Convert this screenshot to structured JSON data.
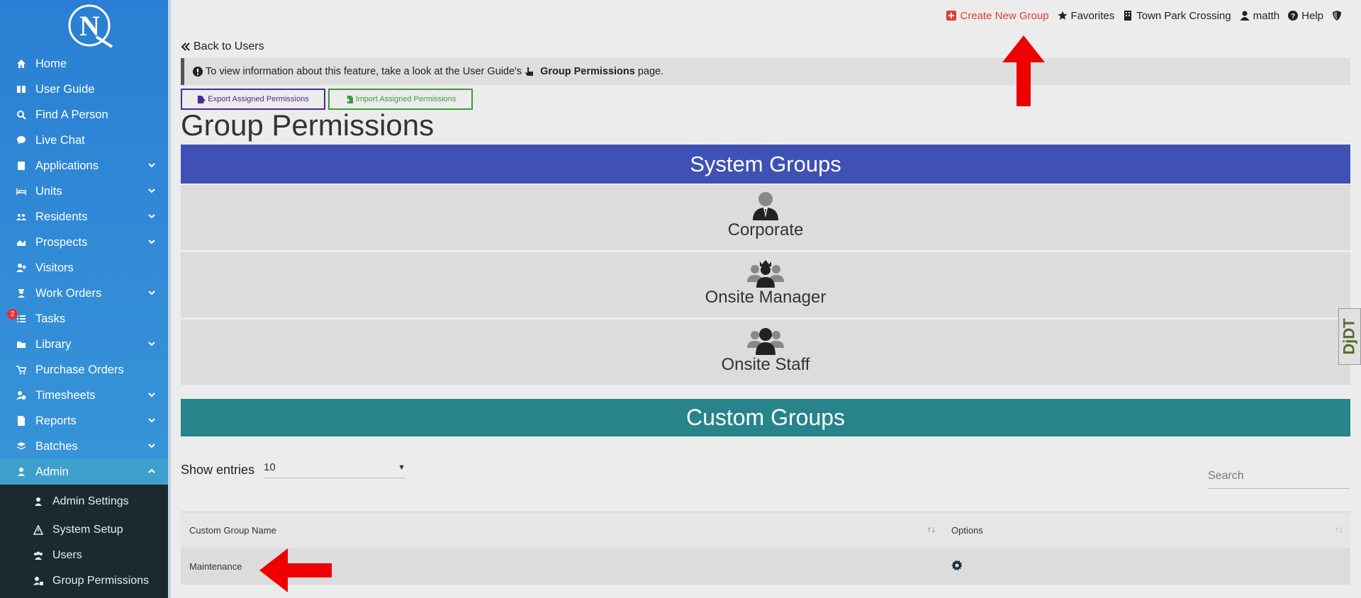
{
  "sidebar": {
    "logo_letters": "NQ",
    "items": [
      {
        "label": "Home",
        "icon": "home-icon",
        "chevron": false
      },
      {
        "label": "User Guide",
        "icon": "book-icon",
        "chevron": false
      },
      {
        "label": "Find A Person",
        "icon": "search-icon",
        "chevron": false
      },
      {
        "label": "Live Chat",
        "icon": "chat-icon",
        "chevron": false
      },
      {
        "label": "Applications",
        "icon": "application-icon",
        "chevron": true
      },
      {
        "label": "Units",
        "icon": "bed-icon",
        "chevron": true
      },
      {
        "label": "Residents",
        "icon": "people-icon",
        "chevron": true
      },
      {
        "label": "Prospects",
        "icon": "prospect-icon",
        "chevron": true
      },
      {
        "label": "Visitors",
        "icon": "user-plus-icon",
        "chevron": false
      },
      {
        "label": "Work Orders",
        "icon": "worker-icon",
        "chevron": true
      },
      {
        "label": "Tasks",
        "icon": "list-icon",
        "chevron": false,
        "badge": "2"
      },
      {
        "label": "Library",
        "icon": "folder-icon",
        "chevron": true
      },
      {
        "label": "Purchase Orders",
        "icon": "cart-icon",
        "chevron": false
      },
      {
        "label": "Timesheets",
        "icon": "user-clock-icon",
        "chevron": true
      },
      {
        "label": "Reports",
        "icon": "file-icon",
        "chevron": true
      },
      {
        "label": "Batches",
        "icon": "layers-icon",
        "chevron": true
      },
      {
        "label": "Admin",
        "icon": "admin-icon",
        "chevron": true,
        "active": true
      }
    ],
    "admin_sub": [
      {
        "label": "Admin Settings",
        "icon": "user-tie-icon"
      },
      {
        "label": "System Setup",
        "icon": "warning-icon"
      },
      {
        "label": "Users",
        "icon": "users-icon"
      },
      {
        "label": "Group Permissions",
        "icon": "user-lock-icon"
      }
    ]
  },
  "topbar": {
    "create_group": "Create New Group",
    "favorites": "Favorites",
    "property": "Town Park Crossing",
    "user": "matth",
    "help": "Help"
  },
  "back_link": "Back to Users",
  "info": {
    "prefix": "To view information about this feature, take a look at the User Guide's",
    "page_name": "Group Permissions",
    "suffix": "page."
  },
  "buttons": {
    "export": "Export Assigned Permissions",
    "import": "Import Assigned Permissions"
  },
  "page_title": "Group Permissions",
  "system_groups": {
    "header": "System Groups",
    "groups": [
      "Corporate",
      "Onsite Manager",
      "Onsite Staff"
    ]
  },
  "custom_groups": {
    "header": "Custom Groups",
    "show_entries_label": "Show entries",
    "entries_value": "10",
    "search_placeholder": "Search",
    "columns": [
      "Custom Group Name",
      "Options"
    ],
    "rows": [
      {
        "name": "Maintenance"
      }
    ]
  },
  "colors": {
    "system_header": "#3f51b5",
    "custom_header": "#26848a",
    "annotation_arrow": "#ee0000"
  },
  "side_tab": "DjDT"
}
